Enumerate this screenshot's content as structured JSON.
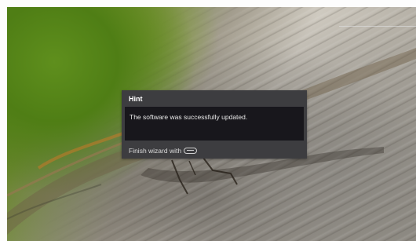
{
  "hint": {
    "title": "Hint",
    "message": "The software was successfully updated.",
    "footer_label": "Finish wizard with",
    "footer_key_icon": "key-icon"
  },
  "colors": {
    "dialog_background": "#3d3d40",
    "message_background": "#18171c",
    "text": "#ffffff"
  }
}
